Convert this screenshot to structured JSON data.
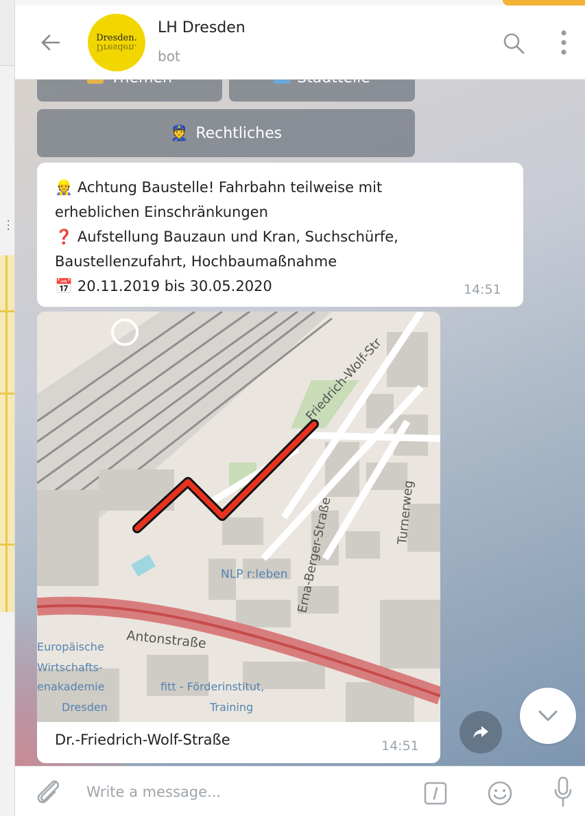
{
  "header": {
    "title": "LH Dresden",
    "subtitle": "bot",
    "avatar_text": "Dresden."
  },
  "keyboard": {
    "themen_label": "Themen",
    "stadtteile_label": "Stadtteile",
    "rechtliches_label": "Rechtliches",
    "rechtliches_emoji": "👮"
  },
  "message": {
    "line1_emoji": "👷",
    "line1": "Achtung Baustelle! Fahrbahn teilweise mit",
    "line2": "erheblichen Einschränkungen",
    "line3_emoji": "❓",
    "line3": "Aufstellung Bauzaun und Kran, Suchschürfe,",
    "line4": "Baustellenzufahrt, Hochbaumaßnahme",
    "line5_emoji": "📅",
    "line5": "20.11.2019 bis 30.05.2020",
    "time": "14:51"
  },
  "map_message": {
    "labels": {
      "friedrich_wolf": "Friedrich-Wolf-Str",
      "erna_berger": "Erna-Berger-Straße",
      "turnerweg": "Turnerweg",
      "nlp": "NLP r:leben",
      "antonstrasse": "Antonstraße",
      "europaeische": "Europäische",
      "wirtschafts": "Wirtschafts-",
      "akademie": "enakademie",
      "dresden": "Dresden",
      "fitt": "fitt - Förderinstitut,",
      "training": "Training"
    },
    "caption": "Dr.-Friedrich-Wolf-Straße",
    "time": "14:51"
  },
  "composer": {
    "placeholder": "Write a message..."
  },
  "colors": {
    "accent": "#f2b233",
    "avatar_bg": "#f2d600",
    "route": "#e8321f"
  },
  "icons": [
    "back-arrow-icon",
    "search-icon",
    "more-vertical-icon",
    "share-icon",
    "chevron-down-icon",
    "paperclip-icon",
    "bot-command-icon",
    "smile-icon",
    "microphone-icon"
  ]
}
